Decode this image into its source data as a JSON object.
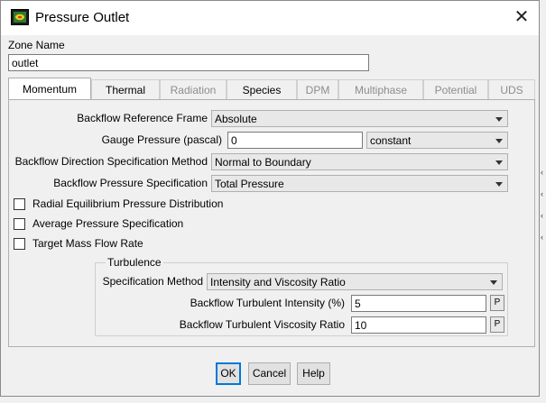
{
  "dialog": {
    "title": "Pressure Outlet",
    "close_glyph": "✕"
  },
  "zone": {
    "label": "Zone Name",
    "value": "outlet"
  },
  "tabs": [
    {
      "label": "Momentum",
      "active": true,
      "enabled": true
    },
    {
      "label": "Thermal",
      "active": false,
      "enabled": true
    },
    {
      "label": "Radiation",
      "active": false,
      "enabled": false
    },
    {
      "label": "Species",
      "active": false,
      "enabled": true
    },
    {
      "label": "DPM",
      "active": false,
      "enabled": false
    },
    {
      "label": "Multiphase",
      "active": false,
      "enabled": false
    },
    {
      "label": "Potential",
      "active": false,
      "enabled": false
    },
    {
      "label": "UDS",
      "active": false,
      "enabled": false
    }
  ],
  "momentum": {
    "backflow_reference_frame": {
      "label": "Backflow Reference Frame",
      "value": "Absolute"
    },
    "gauge_pressure": {
      "label": "Gauge Pressure (pascal)",
      "value": "0",
      "method": "constant"
    },
    "backflow_direction": {
      "label": "Backflow Direction Specification Method",
      "value": "Normal to Boundary"
    },
    "backflow_pressure": {
      "label": "Backflow Pressure Specification",
      "value": "Total Pressure"
    },
    "checkboxes": [
      {
        "label": "Radial Equilibrium Pressure Distribution",
        "checked": false
      },
      {
        "label": "Average Pressure Specification",
        "checked": false
      },
      {
        "label": "Target Mass Flow Rate",
        "checked": false
      }
    ]
  },
  "turbulence": {
    "title": "Turbulence",
    "specification_method": {
      "label": "Specification Method",
      "value": "Intensity and Viscosity Ratio"
    },
    "intensity": {
      "label": "Backflow Turbulent Intensity (%)",
      "value": "5",
      "param_button": "P"
    },
    "viscosity_ratio": {
      "label": "Backflow Turbulent Viscosity Ratio",
      "value": "10",
      "param_button": "P"
    }
  },
  "buttons": {
    "ok": "OK",
    "cancel": "Cancel",
    "help": "Help"
  },
  "colors": {
    "dialog_bg": "#f0f0f0",
    "accent": "#0078d7",
    "disabled_text": "#8d8d8d"
  },
  "icons": {
    "app": "fluent-app-icon",
    "close": "close-icon",
    "dropdown": "chevron-down-icon"
  }
}
